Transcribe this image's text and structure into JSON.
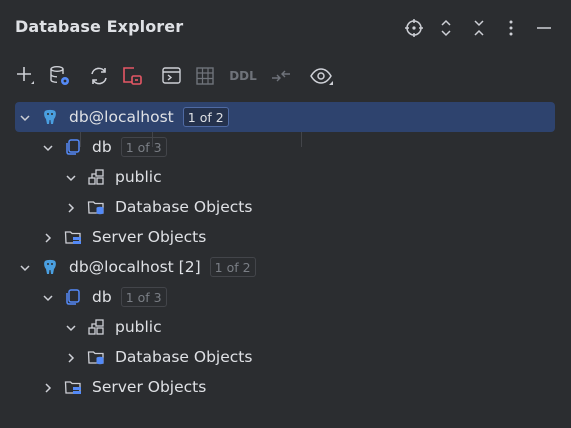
{
  "panel": {
    "title": "Database Explorer",
    "header_icons": [
      "target-icon",
      "expand-icon",
      "collapse-icon",
      "more-icon",
      "minimize-icon"
    ]
  },
  "toolbar": {
    "ddl_label": "DDL"
  },
  "tree": [
    {
      "label": "db@localhost",
      "badge": "1 of 2",
      "selected": true,
      "expanded": true,
      "icon": "postgres-icon"
    },
    {
      "label": "db",
      "badge": "1 of 3",
      "expanded": true,
      "icon": "database-icon"
    },
    {
      "label": "public",
      "expanded": true,
      "icon": "schema-icon"
    },
    {
      "label": "Database Objects",
      "expanded": false,
      "icon": "folder-db-icon"
    },
    {
      "label": "Server Objects",
      "expanded": false,
      "icon": "folder-server-icon"
    },
    {
      "label": "db@localhost [2]",
      "badge": "1 of 2",
      "expanded": true,
      "icon": "postgres-icon"
    },
    {
      "label": "db",
      "badge": "1 of 3",
      "expanded": true,
      "icon": "database-icon"
    },
    {
      "label": "public",
      "expanded": true,
      "icon": "schema-icon"
    },
    {
      "label": "Database Objects",
      "expanded": false,
      "icon": "folder-db-icon"
    },
    {
      "label": "Server Objects",
      "expanded": false,
      "icon": "folder-server-icon"
    }
  ],
  "colors": {
    "background": "#2b2d30",
    "selection": "#2e436e",
    "accent_blue": "#548af7",
    "icon_gray": "#ced0d6",
    "red": "#e55765"
  }
}
